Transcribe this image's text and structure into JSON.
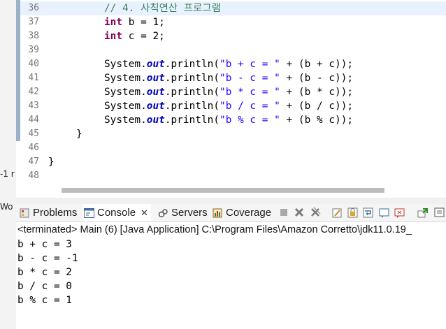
{
  "editor": {
    "lines": [
      {
        "num": "36",
        "comment": "// 4. 사칙연산 프로그램"
      },
      {
        "num": "37",
        "type_kw": "int",
        "decl": " b = 1;"
      },
      {
        "num": "38",
        "type_kw": "int",
        "decl": " c = 2;"
      },
      {
        "num": "39"
      },
      {
        "num": "40",
        "prefix": "System.",
        "field": "out",
        "mid": ".println(",
        "string": "\"b + c = \"",
        "suffix": " + (b + c));"
      },
      {
        "num": "41",
        "prefix": "System.",
        "field": "out",
        "mid": ".println(",
        "string": "\"b - c = \"",
        "suffix": " + (b - c));"
      },
      {
        "num": "42",
        "prefix": "System.",
        "field": "out",
        "mid": ".println(",
        "string": "\"b * c = \"",
        "suffix": " + (b * c));"
      },
      {
        "num": "43",
        "prefix": "System.",
        "field": "out",
        "mid": ".println(",
        "string": "\"b / c = \"",
        "suffix": " + (b / c));"
      },
      {
        "num": "44",
        "prefix": "System.",
        "field": "out",
        "mid": ".println(",
        "string": "\"b % c = \"",
        "suffix": " + (b % c));"
      },
      {
        "num": "45",
        "brace": "}"
      },
      {
        "num": "46"
      },
      {
        "num": "47",
        "brace": "}"
      },
      {
        "num": "48"
      }
    ]
  },
  "left_fragments": {
    "a": "-1 r",
    "b": "Wo"
  },
  "tabs": {
    "problems": "Problems",
    "console": "Console",
    "console_close": "✕",
    "servers": "Servers",
    "coverage": "Coverage"
  },
  "console": {
    "status": "<terminated> Main (6) [Java Application] C:\\Program Files\\Amazon Corretto\\jdk11.0.19_",
    "output": [
      "b + c = 3",
      "b - c = -1",
      "b * c = 2",
      "b / c = 0",
      "b % c = 1"
    ]
  },
  "colors": {
    "comment": "#3f7f5f",
    "keyword": "#7f0055",
    "field": "#0000c0",
    "string": "#2a00ff",
    "current_line": "#e8f2fe"
  }
}
